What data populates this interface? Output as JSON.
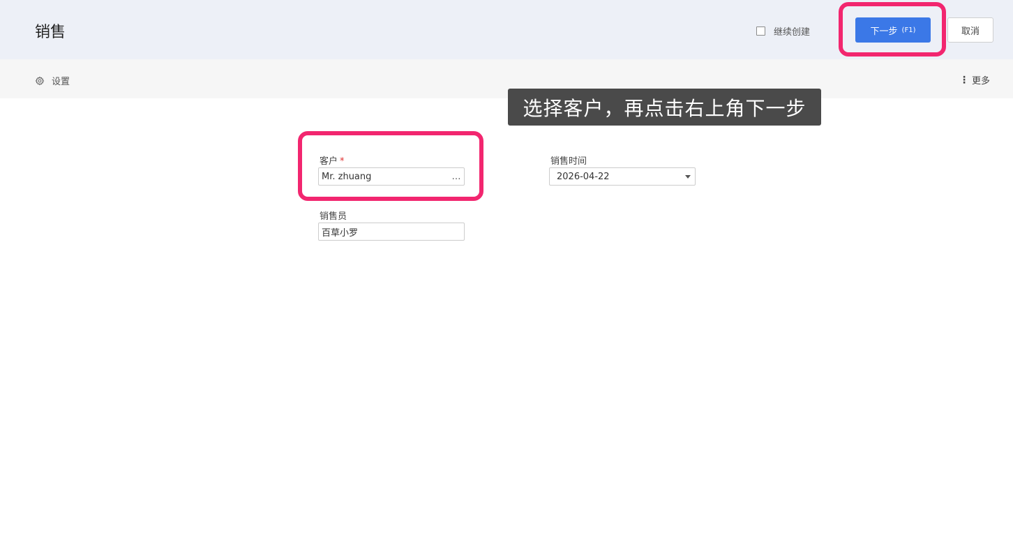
{
  "header": {
    "title": "销售",
    "continue_label": "继续创建",
    "next_label": "下一步",
    "next_hotkey": "(F1)",
    "cancel_label": "取消",
    "highlight_color": "#f2266f",
    "primary_color": "#3b78e7"
  },
  "toolbar": {
    "settings_label": "设置",
    "settings_icon": "gear-icon",
    "more_label": "更多",
    "more_icon": "vertical-dots-icon"
  },
  "tooltip": {
    "text": "选择客户，再点击右上角下一步"
  },
  "form": {
    "customer": {
      "label": "客户",
      "required_mark": "*",
      "value": "Mr. zhuang",
      "action_icon": "…"
    },
    "sale_time": {
      "label": "销售时间",
      "value": "2026-04-22"
    },
    "salesperson": {
      "label": "销售员",
      "value": "百草小罗"
    }
  }
}
